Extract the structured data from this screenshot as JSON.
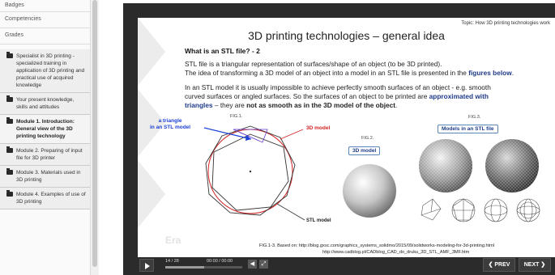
{
  "sidebar": {
    "links": [
      "Badges",
      "Competencies",
      "Grades"
    ],
    "modules": [
      {
        "label": "Specialist in 3D printing - specialized training in application of 3D printing and practical use of acquired knowledge",
        "active": false
      },
      {
        "label": "Your present knowledge, skills and attitudes",
        "active": false
      },
      {
        "label": "Module 1. Introduction: General view of the 3D printing technology",
        "active": true
      },
      {
        "label": "Module 2. Preparing of input file for 3D printer",
        "active": false
      },
      {
        "label": "Module 3. Materials used in 3D printing",
        "active": false
      },
      {
        "label": "Module 4. Examples of use of 3D printing",
        "active": false
      }
    ]
  },
  "slide": {
    "topic": "Topic: How 3D printing technologies work",
    "title": "3D printing technologies – general idea",
    "question": "What is an STL file? - 2",
    "p1_line1": "STL file is a triangular representation of surfaces/shape of an object (to be 3D printed).",
    "p1_line2_a": "The idea of transforming a 3D model of an object into a model in an STL file is presented in the ",
    "p1_line2_link": "figures below",
    "p1_line2_end": ".",
    "p2_line1": "In an STL model it is usually impossible to achieve perfectly smooth surfaces of an object - e.g. smooth",
    "p2_line2_a": "curved surfaces or angled surfaces. So the surfaces of an object to be printed are ",
    "p2_line2_b": "approximated with",
    "p2_line3_a": "triangles",
    "p2_line3_b": " – they are ",
    "p2_line3_c": "not as smooth as in the 3D model of the object",
    "p2_line3_d": ".",
    "fig1": {
      "label": "FIG.1.",
      "triangle_label_1": "a triangle",
      "triangle_label_2": "in an STL model",
      "model_label": "3D model",
      "stl_label": "STL model"
    },
    "fig2": {
      "label": "FIG.2.",
      "box": "3D model"
    },
    "fig3": {
      "label": "FIG.3.",
      "box": "Models in an STL file"
    },
    "caption_line1": "FIG.1-3. Based on:  http://blog.gxsc.com/graphics_systems_solidmo/2015/09/solidworks-modeling-for-3d-printing.html",
    "caption_line2": "http://www.cadblog.pl/CADblog_CAD_do_druku_3D_STL_AMF_3MF.htm",
    "faded_logo": "Era"
  },
  "controls": {
    "counter": "14 / 28",
    "timer": "00:00 / 00:00",
    "progress": 0.5,
    "prev": "❮  PREV",
    "next": "NEXT  ❯"
  },
  "colors": {
    "accent": "#1f3b8a",
    "annotation_blue": "#1a3fd6",
    "annotation_red": "#d22222",
    "player_bg": "#2b2b2b"
  }
}
